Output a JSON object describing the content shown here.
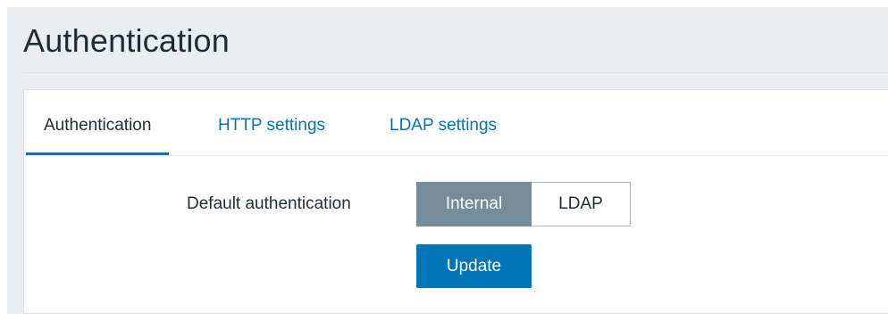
{
  "page": {
    "title": "Authentication"
  },
  "tabs": [
    {
      "label": "Authentication",
      "active": true
    },
    {
      "label": "HTTP settings",
      "active": false
    },
    {
      "label": "LDAP settings",
      "active": false
    }
  ],
  "form": {
    "default_auth_label": "Default authentication",
    "options": [
      {
        "label": "Internal",
        "selected": true
      },
      {
        "label": "LDAP",
        "selected": false
      }
    ],
    "update_label": "Update"
  },
  "colors": {
    "background": "#ebeef0",
    "accent": "#0275b8",
    "selected_segment": "#768d99",
    "text": "#1f2c33"
  }
}
